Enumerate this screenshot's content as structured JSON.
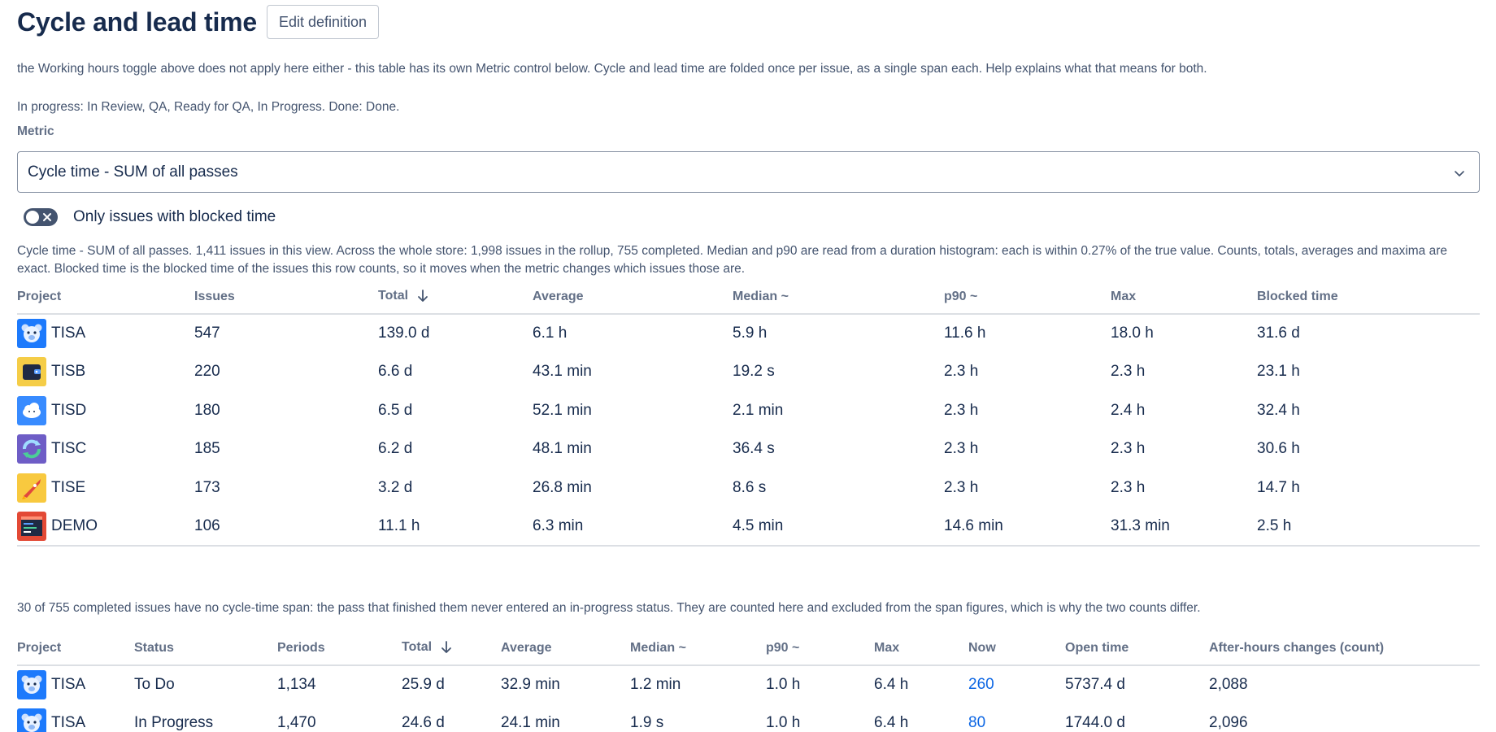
{
  "header": {
    "title": "Cycle and lead time",
    "edit_label": "Edit definition"
  },
  "intro": {
    "note": "the Working hours toggle above does not apply here either - this table has its own Metric control below. Cycle and lead time are folded once per issue, as a single span each. Help explains what that means for both.",
    "statuses": "In progress: In Review, QA, Ready for QA, In Progress. Done: Done."
  },
  "metric": {
    "label": "Metric",
    "selected": "Cycle time - SUM of all passes"
  },
  "toggle": {
    "label": "Only issues with blocked time",
    "on": false
  },
  "summary": "Cycle time - SUM of all passes. 1,411 issues in this view. Across the whole store: 1,998 issues in the rollup, 755 completed. Median and p90 are read from a duration histogram: each is within 0.27% of the true value. Counts, totals, averages and maxima are exact. Blocked time is the blocked time of the issues this row counts, so it moves when the metric changes which issues those are.",
  "table1": {
    "columns": [
      "Project",
      "Issues",
      "Total",
      "Average",
      "Median ~",
      "p90 ~",
      "Max",
      "Blocked time"
    ],
    "rows": [
      {
        "avatar": "bear",
        "project": "TISA",
        "cells": [
          "547",
          "139.0 d",
          "6.1 h",
          "5.9 h",
          "11.6 h",
          "18.0 h",
          "31.6 d"
        ]
      },
      {
        "avatar": "wallet",
        "project": "TISB",
        "cells": [
          "220",
          "6.6 d",
          "43.1 min",
          "19.2 s",
          "2.3 h",
          "2.3 h",
          "23.1 h"
        ]
      },
      {
        "avatar": "cloud",
        "project": "TISD",
        "cells": [
          "180",
          "6.5 d",
          "52.1 min",
          "2.1 min",
          "2.3 h",
          "2.4 h",
          "32.4 h"
        ]
      },
      {
        "avatar": "refresh",
        "project": "TISC",
        "cells": [
          "185",
          "6.2 d",
          "48.1 min",
          "36.4 s",
          "2.3 h",
          "2.3 h",
          "30.6 h"
        ]
      },
      {
        "avatar": "rocket",
        "project": "TISE",
        "cells": [
          "173",
          "3.2 d",
          "26.8 min",
          "8.6 s",
          "2.3 h",
          "2.3 h",
          "14.7 h"
        ]
      },
      {
        "avatar": "screen",
        "project": "DEMO",
        "cells": [
          "106",
          "11.1 h",
          "6.3 min",
          "4.5 min",
          "14.6 min",
          "31.3 min",
          "2.5 h"
        ]
      }
    ]
  },
  "excluded_note": "30 of 755 completed issues have no cycle-time span: the pass that finished them never entered an in-progress status. They are counted here and excluded from the span figures, which is why the two counts differ.",
  "table2": {
    "columns": [
      "Project",
      "Status",
      "Periods",
      "Total",
      "Average",
      "Median ~",
      "p90 ~",
      "Max",
      "Now",
      "Open time",
      "After-hours changes (count)"
    ],
    "rows": [
      {
        "avatar": "bear",
        "project": "TISA",
        "cells": [
          "To Do",
          "1,134",
          "25.9 d",
          "32.9 min",
          "1.2 min",
          "1.0 h",
          "6.4 h",
          "260",
          "5737.4 d",
          "2,088"
        ]
      },
      {
        "avatar": "bear",
        "project": "TISA",
        "cells": [
          "In Progress",
          "1,470",
          "24.6 d",
          "24.1 min",
          "1.9 s",
          "1.0 h",
          "6.4 h",
          "80",
          "1744.0 d",
          "2,096"
        ]
      }
    ]
  },
  "icons": {
    "sort": "arrow-down-icon",
    "select": "chevron-down-icon",
    "toggle": "close-icon"
  },
  "colors": {
    "link": "#0c66e4",
    "toggle_off": "#44546f"
  }
}
